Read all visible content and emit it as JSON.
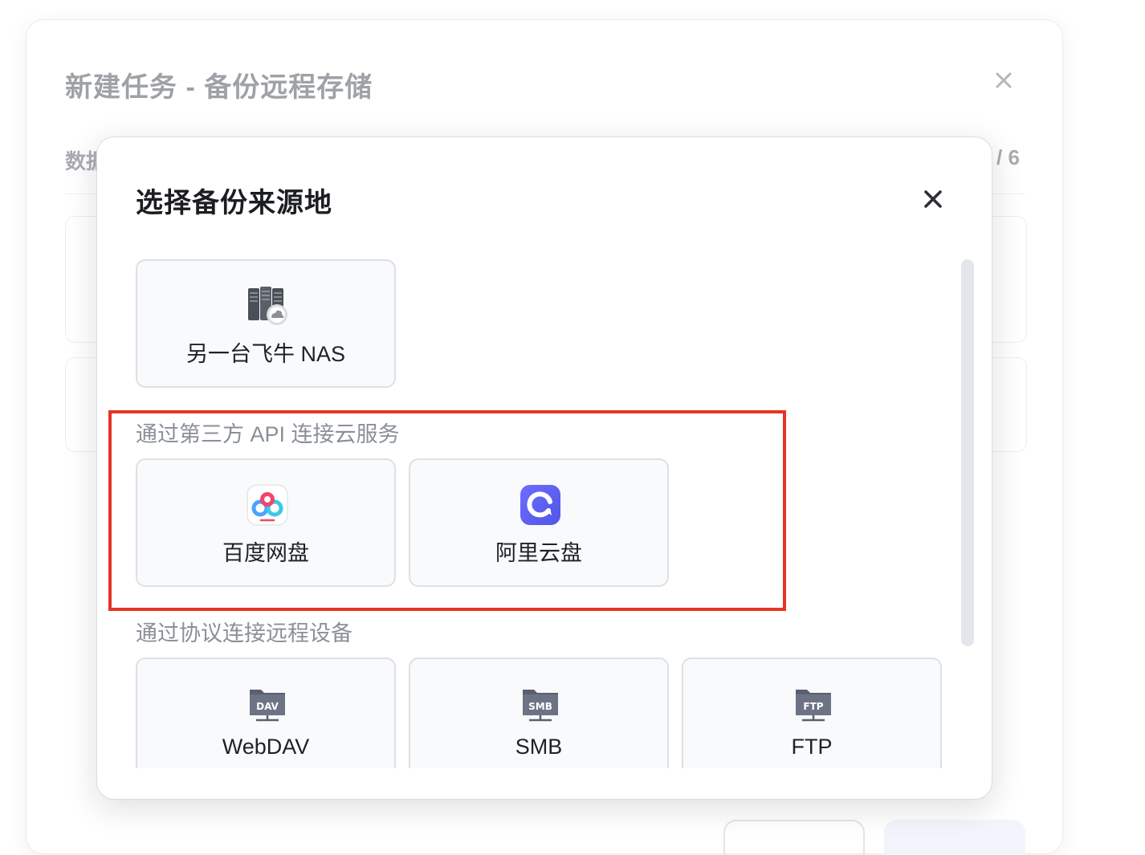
{
  "background_dialog": {
    "title": "新建任务 - 备份远程存储",
    "step_label": "数据",
    "step_count": "/ 6",
    "close_icon": "close-icon"
  },
  "modal": {
    "title": "选择备份来源地",
    "close_icon": "close-icon",
    "top_option": {
      "label": "另一台飞牛 NAS",
      "icon": "nas-server-cloud-icon"
    },
    "cloud_section": {
      "label": "通过第三方 API 连接云服务",
      "options": [
        {
          "label": "百度网盘",
          "icon": "baidu-netdisk-icon"
        },
        {
          "label": "阿里云盘",
          "icon": "aliyun-drive-icon"
        }
      ]
    },
    "protocol_section": {
      "label": "通过协议连接远程设备",
      "options": [
        {
          "label": "WebDAV",
          "icon": "webdav-folder-icon",
          "badge": "DAV"
        },
        {
          "label": "SMB",
          "icon": "smb-folder-icon",
          "badge": "SMB"
        },
        {
          "label": "FTP",
          "icon": "ftp-folder-icon",
          "badge": "FTP"
        }
      ]
    }
  },
  "colors": {
    "highlight": "#e53524",
    "card_bg": "#f9fafb",
    "card_border": "#dde0e5",
    "section_label": "#8a9099",
    "aliyun_brand": "#5b5ff0"
  }
}
